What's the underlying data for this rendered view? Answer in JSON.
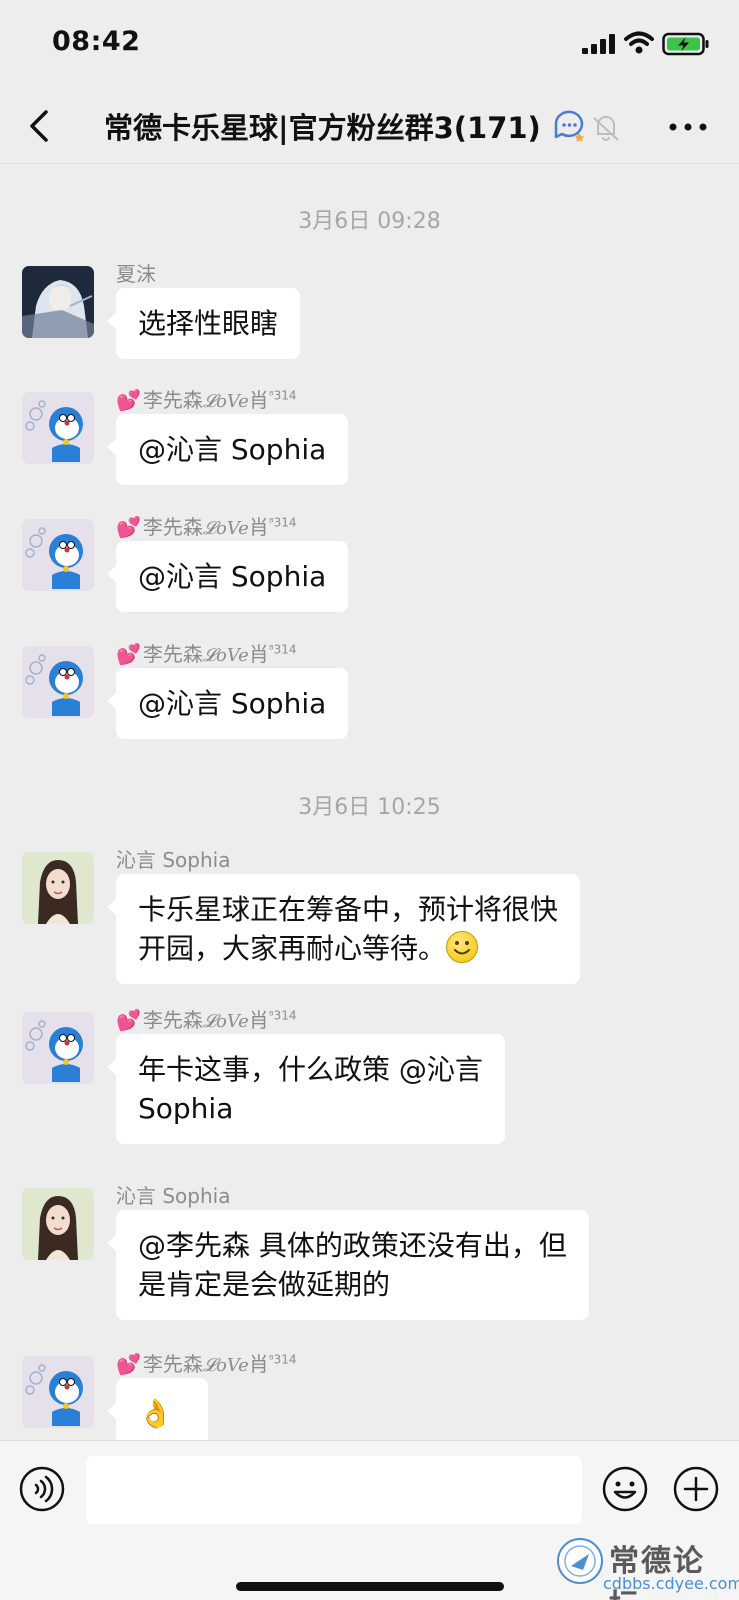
{
  "status_bar": {
    "time": "08:42"
  },
  "nav": {
    "title": "常德卡乐星球|官方粉丝群3(171)"
  },
  "timestamps": [
    "3月6日 09:28",
    "3月6日 10:25"
  ],
  "messages": [
    {
      "sender": "夏沫",
      "text": "选择性眼瞎"
    },
    {
      "sender": "李先森",
      "sender_love": "𝓛oVe",
      "sender_tail": "肖",
      "sender_sup": "⁸314",
      "text": "@沁言 Sophia"
    },
    {
      "sender": "李先森",
      "sender_love": "𝓛oVe",
      "sender_tail": "肖",
      "sender_sup": "⁸314",
      "text": "@沁言 Sophia"
    },
    {
      "sender": "李先森",
      "sender_love": "𝓛oVe",
      "sender_tail": "肖",
      "sender_sup": "⁸314",
      "text": "@沁言 Sophia"
    },
    {
      "sender": "沁言 Sophia",
      "text_line1": "卡乐星球正在筹备中，预计将很快",
      "text_line2": "开园，大家再耐心等待。"
    },
    {
      "sender": "李先森",
      "sender_love": "𝓛oVe",
      "sender_tail": "肖",
      "sender_sup": "⁸314",
      "text_line1": "年卡这事，什么政策 @沁言",
      "text_line2": "Sophia"
    },
    {
      "sender": "沁言 Sophia",
      "text_line1": "@李先森 具体的政策还没有出，但",
      "text_line2": "是肯定是会做延期的"
    },
    {
      "sender": "李先森",
      "sender_love": "𝓛oVe",
      "sender_tail": "肖",
      "sender_sup": "⁸314",
      "text": "👌"
    }
  ],
  "input": {
    "placeholder": ""
  },
  "watermark": {
    "title": "常德论坛",
    "url": "cdbbs.cdyee.com"
  },
  "colors": {
    "background": "#ededed",
    "bubble": "#ffffff",
    "sender_name": "#8c8c8c",
    "heart": "#e8408a"
  },
  "icons": [
    "back-chevron-icon",
    "signal-icon",
    "wifi-icon",
    "battery-charging-icon",
    "group-chat-icon",
    "mute-bell-icon",
    "more-dots-icon",
    "voice-icon",
    "emoji-icon",
    "plus-icon"
  ]
}
